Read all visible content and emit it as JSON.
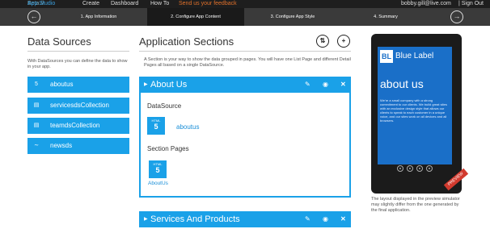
{
  "topbar": {
    "brand": "App Studio",
    "beta": "Beta //",
    "nav": [
      "Create",
      "Dashboard",
      "How To"
    ],
    "feedback": "Send us your feedback",
    "user": "bobby.gill@live.com",
    "signout": "| Sign Out"
  },
  "steps": [
    {
      "label": "1. App Information"
    },
    {
      "label": "2. Configure App Content"
    },
    {
      "label": "3. Configure App Style"
    },
    {
      "label": "4. Summary"
    }
  ],
  "data_sources": {
    "title": "Data Sources",
    "description": "With DataSources you can define the data to show in your app.",
    "items": [
      {
        "label": "aboutus",
        "icon": "html5-icon"
      },
      {
        "label": "servicesdsCollection",
        "icon": "collection-icon"
      },
      {
        "label": "teamdsCollection",
        "icon": "collection-icon"
      },
      {
        "label": "newsds",
        "icon": "rss-icon"
      }
    ]
  },
  "app_sections": {
    "title": "Application Sections",
    "description": "A Section is your way to show the data grouped in pages. You will have one List Page and different Detail Pages all based on a single DataSource.",
    "sections": [
      {
        "title": "About Us",
        "datasource_label": "DataSource",
        "datasource_name": "aboutus",
        "pages_label": "Section Pages",
        "page_name": "AboutUs"
      },
      {
        "title": "Services And Products"
      }
    ]
  },
  "preview": {
    "brand_short": "BL",
    "brand_name": "Blue Label",
    "page_title": "about us",
    "page_text": "We're a small company with a strong commitment to our clients. We build great sites with an exclusive design style that allows our clients to speak to each customer in a unique voice, and our sites work on all devices and all browsers.",
    "badge": "PREVIEW",
    "note": "The layout displayed in the preview simulator may slightly differ from the one generated by the final application."
  },
  "colors": {
    "accent": "#1aa1e8",
    "dark_bar": "#3a3a3a",
    "feedback": "#e0702a",
    "phone_screen": "#1a6fc8"
  }
}
